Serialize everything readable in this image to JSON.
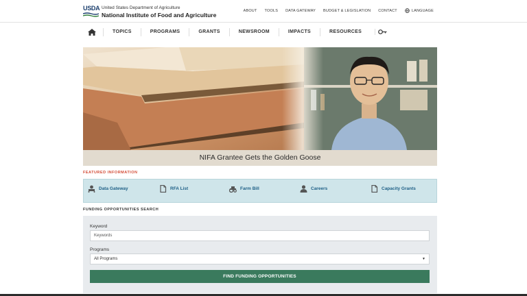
{
  "header": {
    "logo_mark": "USDA",
    "dept": "United States Department of Agriculture",
    "institute": "National Institute of Food and Agriculture",
    "utility_links": [
      "ABOUT",
      "TOOLS",
      "DATA GATEWAY",
      "BUDGET & LEGISLATION",
      "CONTACT"
    ],
    "language": "LANGUAGE"
  },
  "nav": {
    "items": [
      "TOPICS",
      "PROGRAMS",
      "GRANTS",
      "NEWSROOM",
      "IMPACTS",
      "RESOURCES"
    ]
  },
  "hero": {
    "caption": "NIFA Grantee Gets the Golden Goose"
  },
  "featured": {
    "label": "FEATURED INFORMATION",
    "items": [
      {
        "label": "Data Gateway",
        "icon": "data-gateway-icon"
      },
      {
        "label": "RFA List",
        "icon": "document-icon"
      },
      {
        "label": "Farm Bill",
        "icon": "tractor-icon"
      },
      {
        "label": "Careers",
        "icon": "person-icon"
      },
      {
        "label": "Capacity Grants",
        "icon": "document-icon"
      }
    ]
  },
  "funding": {
    "label": "FUNDING OPPORTUNITIES SEARCH",
    "keyword_label": "Keyword",
    "keyword_placeholder": "Keywords",
    "programs_label": "Programs",
    "programs_value": "All Programs",
    "button": "FIND FUNDING OPPORTUNITIES"
  },
  "colors": {
    "accent_red": "#d34b36",
    "link_blue": "#1e5f86",
    "featured_bg": "#cfe5ea",
    "button_green": "#3a7a5d"
  }
}
